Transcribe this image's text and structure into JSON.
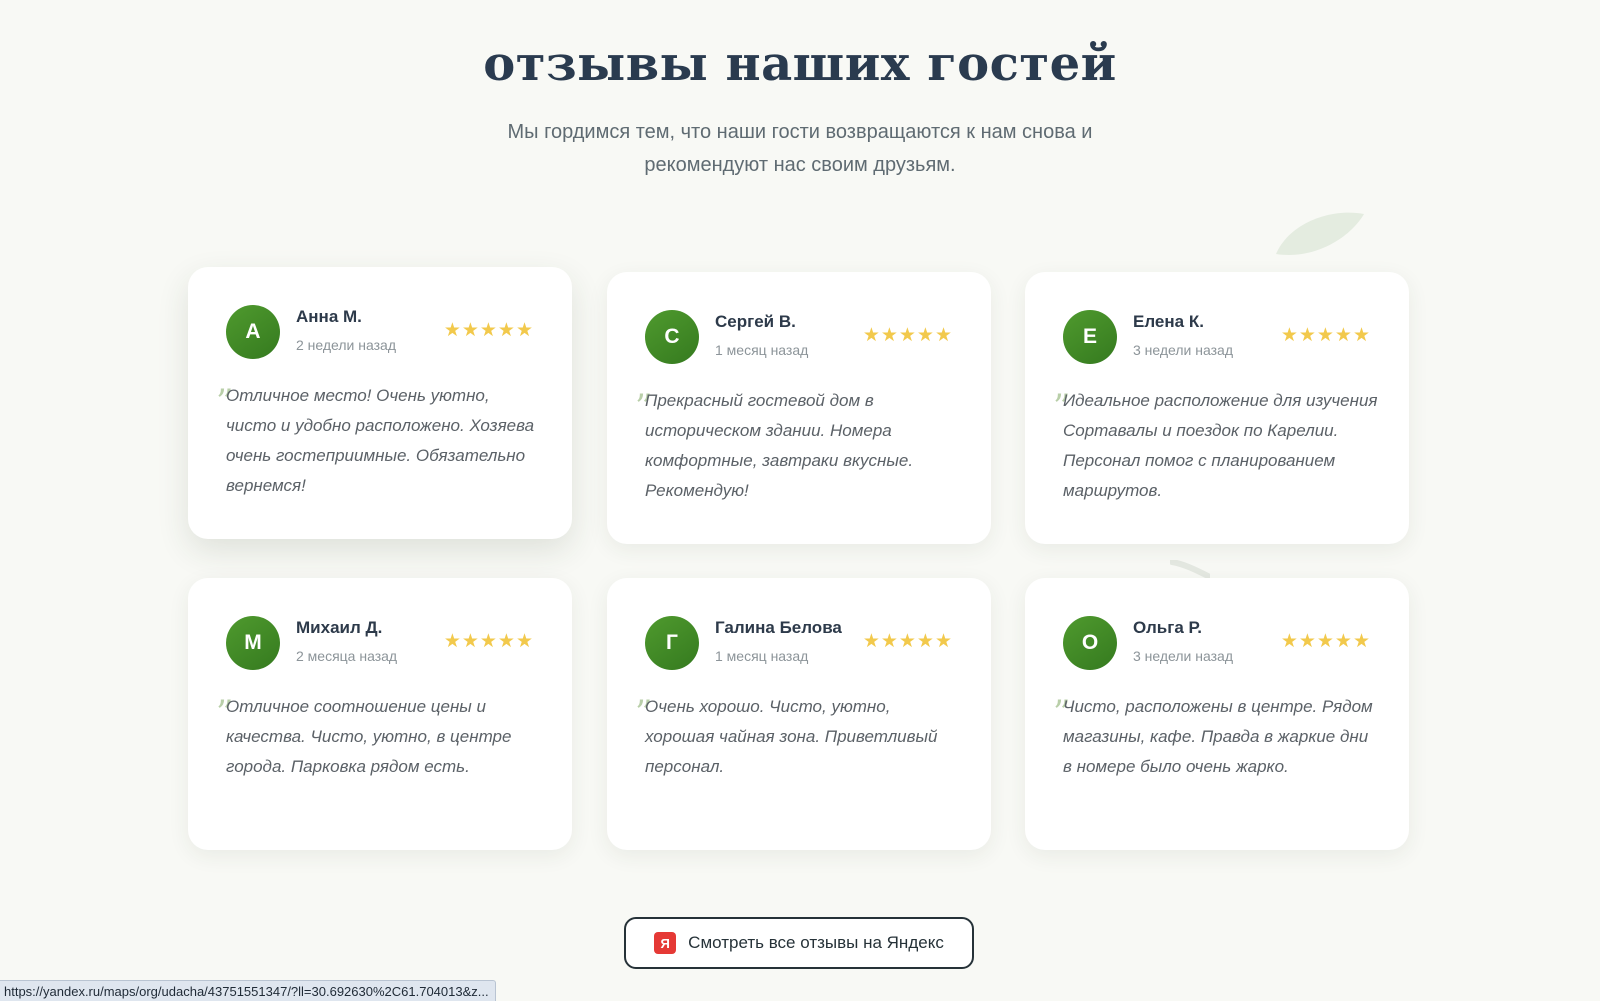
{
  "section": {
    "title": "отзывы наших гостей",
    "subtitle": "Мы гордимся тем, что наши гости возвращаются к нам снова и рекомендуют нас своим друзьям."
  },
  "reviews": [
    {
      "initial": "А",
      "name": "Анна М.",
      "date": "2 недели назад",
      "stars": "★★★★★",
      "rating": 5,
      "text": "Отличное место! Очень уютно, чисто и удобно расположено. Хозяева очень гостеприимные. Обязательно вернемся!"
    },
    {
      "initial": "С",
      "name": "Сергей В.",
      "date": "1 месяц назад",
      "stars": "★★★★★",
      "rating": 5,
      "text": "Прекрасный гостевой дом в историческом здании. Номера комфортные, завтраки вкусные. Рекомендую!"
    },
    {
      "initial": "Е",
      "name": "Елена К.",
      "date": "3 недели назад",
      "stars": "★★★★★",
      "rating": 5,
      "text": "Идеальное расположение для изучения Сортавалы и поездок по Карелии. Персонал помог с планированием маршрутов."
    },
    {
      "initial": "М",
      "name": "Михаил Д.",
      "date": "2 месяца назад",
      "stars": "★★★★★",
      "rating": 5,
      "text": "Отличное соотношение цены и качества. Чисто, уютно, в центре города. Парковка рядом есть."
    },
    {
      "initial": "Г",
      "name": "Галина Белова",
      "date": "1 месяц назад",
      "stars": "★★★★★",
      "rating": 5,
      "text": "Очень хорошо. Чисто, уютно, хорошая чайная зона. Приветливый персонал."
    },
    {
      "initial": "О",
      "name": "Ольга Р.",
      "date": "3 недели назад",
      "stars": "★★★★★",
      "rating": 5,
      "text": "Чисто, расположены в центре. Рядом магазины, кафе. Правда в жаркие дни в номере было очень жарко."
    }
  ],
  "quote_glyph": "”",
  "button": {
    "logo_letter": "Я",
    "label": "Смотреть все отзывы на Яндекс"
  },
  "status_bar": {
    "url": "https://yandex.ru/maps/org/udacha/43751551347/?ll=30.692630%2C61.704013&z..."
  },
  "icons": {
    "star": "star-icon",
    "quote": "quote-icon",
    "yandex": "yandex-logo-icon",
    "leaf": "leaf-decoration-icon"
  },
  "colors": {
    "background": "#f8f9f5",
    "avatar_green": "#3f8a25",
    "star_yellow": "#f2c94c",
    "title": "#2a3b4f",
    "yandex_red": "#e53935"
  }
}
